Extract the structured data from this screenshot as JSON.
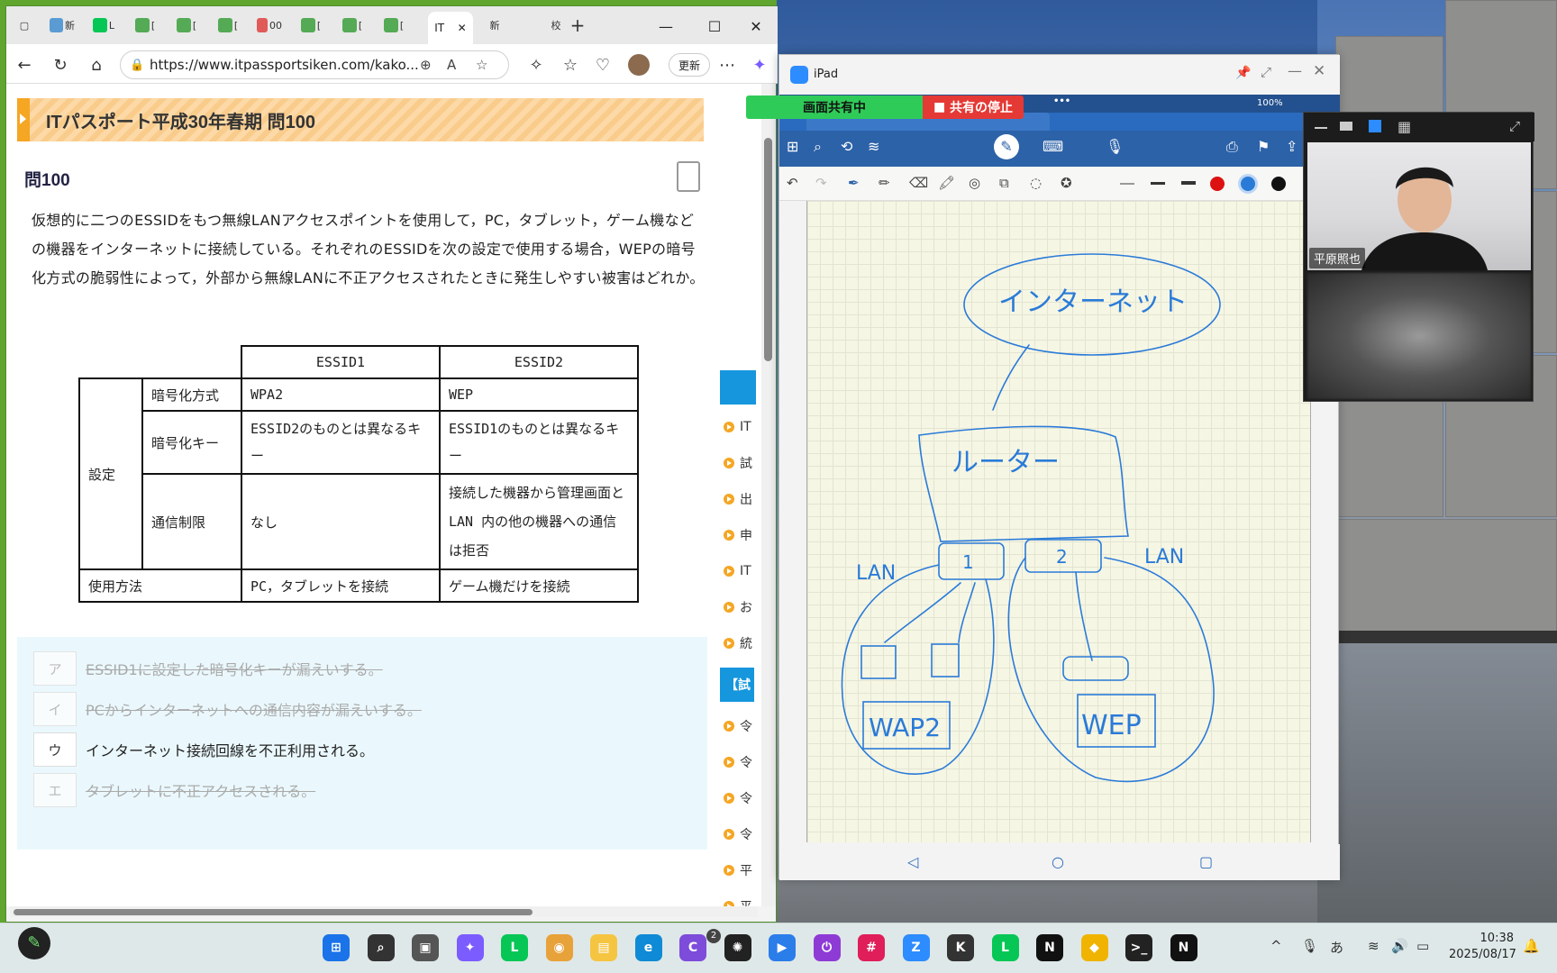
{
  "browser": {
    "tabs": [
      {
        "label": "新",
        "color": "#5a9bd4"
      },
      {
        "label": "L",
        "color": "#06c755"
      },
      {
        "label": "[",
        "color": "#55aa55"
      },
      {
        "label": "[",
        "color": "#55aa55"
      },
      {
        "label": "[",
        "color": "#55aa55"
      },
      {
        "label": "00",
        "color": "#e05a5a"
      },
      {
        "label": "[",
        "color": "#55aa55"
      },
      {
        "label": "[",
        "color": "#55aa55"
      },
      {
        "label": "[",
        "color": "#55aa55"
      }
    ],
    "active_tab": "IT",
    "extra_tab": "新",
    "extra_tab2": "校",
    "url": "https://www.itpassportsiken.com/kako...",
    "update_label": "更新"
  },
  "page": {
    "title": "ITパスポート平成30年春期 問100",
    "question_no": "問100",
    "question_text": "仮想的に二つのESSIDをもつ無線LANアクセスポイントを使用して，PC，タブレット，ゲーム機などの機器をインターネットに接続している。それぞれのESSIDを次の設定で使用する場合，WEPの暗号化方式の脆弱性によって，外部から無線LANに不正アクセスされたときに発生しやすい被害はどれか。",
    "table": {
      "col1": "ESSID1",
      "col2": "ESSID2",
      "group": "設定",
      "rows": [
        {
          "label": "暗号化方式",
          "v1": "WPA2",
          "v2": "WEP"
        },
        {
          "label": "暗号化キー",
          "v1": "ESSID2のものとは異なるキー",
          "v2": "ESSID1のものとは異なるキー"
        },
        {
          "label": "通信制限",
          "v1": "なし",
          "v2": "接続した機器から管理画面と LAN 内の他の機器への通信は拒否"
        }
      ],
      "usage_label": "使用方法",
      "usage_v1": "PC，タブレットを接続",
      "usage_v2": "ゲーム機だけを接続"
    },
    "choices": [
      {
        "label": "ア",
        "text": "ESSID1に設定した暗号化キーが漏えいする。",
        "struck": true
      },
      {
        "label": "イ",
        "text": "PCからインターネットへの通信内容が漏えいする。",
        "struck": true
      },
      {
        "label": "ウ",
        "text": "インターネット接続回線を不正利用される。",
        "struck": false
      },
      {
        "label": "エ",
        "text": "タブレットに不正アクセスされる。",
        "struck": true
      }
    ],
    "sidebar_items": [
      "IT",
      "試",
      "出",
      "申",
      "IT",
      "お",
      "統"
    ],
    "sidebar_head": "【試",
    "sidebar_items2": [
      "令",
      "令",
      "令",
      "令",
      "平",
      "平"
    ]
  },
  "share": {
    "sharing": "画面共有中",
    "stop": "共有の停止"
  },
  "ipad": {
    "title": "iPad",
    "status": "100%",
    "handwriting": {
      "internet": "インターネット",
      "router": "ルーター",
      "lan_left": "LAN",
      "lan_right": "LAN",
      "port1": "1",
      "port2": "2",
      "wpa2": "WAP2",
      "wep": "WEP"
    }
  },
  "video": {
    "name": "平原照也"
  },
  "taskbar": {
    "apps": [
      {
        "name": "start",
        "color": "#1a73e8"
      },
      {
        "name": "search",
        "color": "#333"
      },
      {
        "name": "taskview",
        "color": "#555"
      },
      {
        "name": "copilot",
        "color": "#7b5cff"
      },
      {
        "name": "line",
        "color": "#06c755"
      },
      {
        "name": "chrome",
        "color": "#e8a23a"
      },
      {
        "name": "explorer",
        "color": "#f5c542"
      },
      {
        "name": "edge",
        "color": "#0f8ad6"
      },
      {
        "name": "canva",
        "color": "#7d4cdb"
      },
      {
        "name": "chatgpt",
        "color": "#222"
      },
      {
        "name": "app",
        "color": "#2b7de9"
      },
      {
        "name": "power",
        "color": "#8e3bd6"
      },
      {
        "name": "slack",
        "color": "#e01e5a"
      },
      {
        "name": "zoom",
        "color": "#2d8cff"
      },
      {
        "name": "klack",
        "color": "#333"
      },
      {
        "name": "line2",
        "color": "#06c755"
      },
      {
        "name": "notion",
        "color": "#111"
      },
      {
        "name": "duck",
        "color": "#f0b400"
      },
      {
        "name": "terminal",
        "color": "#222"
      },
      {
        "name": "notion2",
        "color": "#111"
      }
    ],
    "canva_badge": "2",
    "ime": "あ",
    "time": "10:38",
    "date": "2025/08/17"
  }
}
